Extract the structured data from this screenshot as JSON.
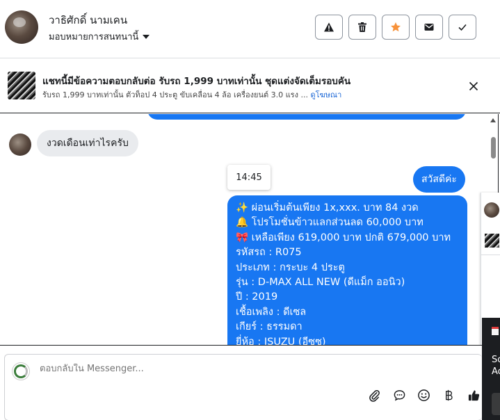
{
  "header": {
    "contact_name": "วาธิศักดิ์ นามเคน",
    "assign_label": "มอบหมายการสนทนานี้",
    "buttons": [
      {
        "name": "report-button",
        "icon": "warning-icon"
      },
      {
        "name": "delete-button",
        "icon": "trash-icon"
      },
      {
        "name": "star-button",
        "icon": "star-icon",
        "color": "#f7923a"
      },
      {
        "name": "mark-unread-button",
        "icon": "envelope-icon"
      },
      {
        "name": "mark-done-button",
        "icon": "check-icon"
      }
    ]
  },
  "ad_banner": {
    "title": "แชทนี้มีข้อความตอบกลับต่อ รับรถ 1,999 บาทเท่านั้น ชุดแต่งจัดเต็มรอบคัน",
    "subtitle": "รับรถ 1,999 บาทเท่านั้น ตัวท็อป 4 ประตู ขับเคลื่อน 4 ล้อ เครื่องยนต์ 3.0 แรง ...",
    "link": "ดูโฆษณา"
  },
  "messages": {
    "incoming": "งวดเดือนเท่าไรครับ",
    "timestamp": "14:45",
    "outgoing_greeting": "สวัสดีค่ะ",
    "outgoing_details": [
      "✨  ผ่อนเริ่มต้นเพียง 1x,xxx. บาท 84 งวด",
      "🔔 โปรโมชั่นข้าวแลกส่วนลด 60,000 บาท",
      "🎀  เหลือเพียง 619,000 บาท ปกติ 679,000 บาท",
      " รหัสรถ : R075",
      " ประเภท : กระบะ 4 ประตู",
      " รุ่น : D-MAX ALL NEW (ดีแม็ก ออนิว)",
      " ปี : 2019",
      " เชื้อเพลิง : ดีเซล",
      " เกียร์ : ธรรมดา",
      " ยี่ห้อ : ISUZU (อีซูซุ)"
    ]
  },
  "side_panel": {
    "line1": "So",
    "line2": "Ac"
  },
  "composer": {
    "placeholder": "ตอบกลับใน Messenger...",
    "tools": [
      "attach-icon",
      "saved-reply-icon",
      "emoji-icon",
      "baht-payment-icon",
      "thumbs-up-icon"
    ]
  },
  "colors": {
    "messenger_blue": "#1877f2",
    "incoming_bubble": "#e9ebee",
    "star_orange": "#f7923a",
    "link_blue": "#1a66d6"
  }
}
